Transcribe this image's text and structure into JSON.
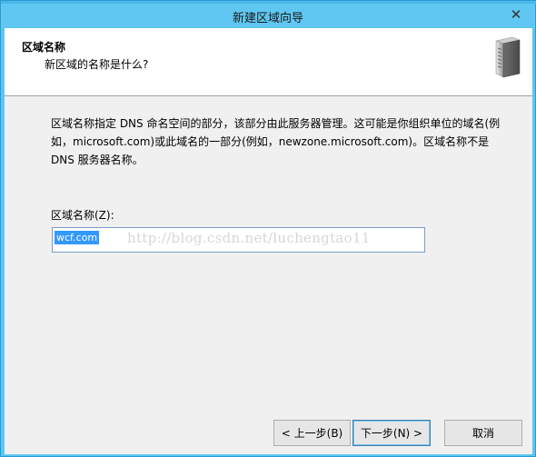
{
  "window": {
    "title": "新建区域向导",
    "close_glyph": "✕"
  },
  "header": {
    "title": "区域名称",
    "subtitle": "新区域的名称是什么?"
  },
  "body": {
    "description": "区域名称指定 DNS 命名空间的部分，该部分由此服务器管理。这可能是你组织单位的域名(例如，microsoft.com)或此域名的一部分(例如，newzone.microsoft.com)。区域名称不是 DNS 服务器名称。",
    "zone_name_label": "区域名称(Z):",
    "zone_name_value": "wcf.com",
    "watermark": "http://blog.csdn.net/luchengtao11"
  },
  "buttons": {
    "back": "< 上一步(B)",
    "next": "下一步(N) >",
    "cancel": "取消"
  },
  "colors": {
    "titlebar": "#5fc7f1",
    "selection": "#3399ff",
    "client_bg": "#f0f0f0"
  },
  "icons": {
    "header_icon": "server-icon"
  }
}
